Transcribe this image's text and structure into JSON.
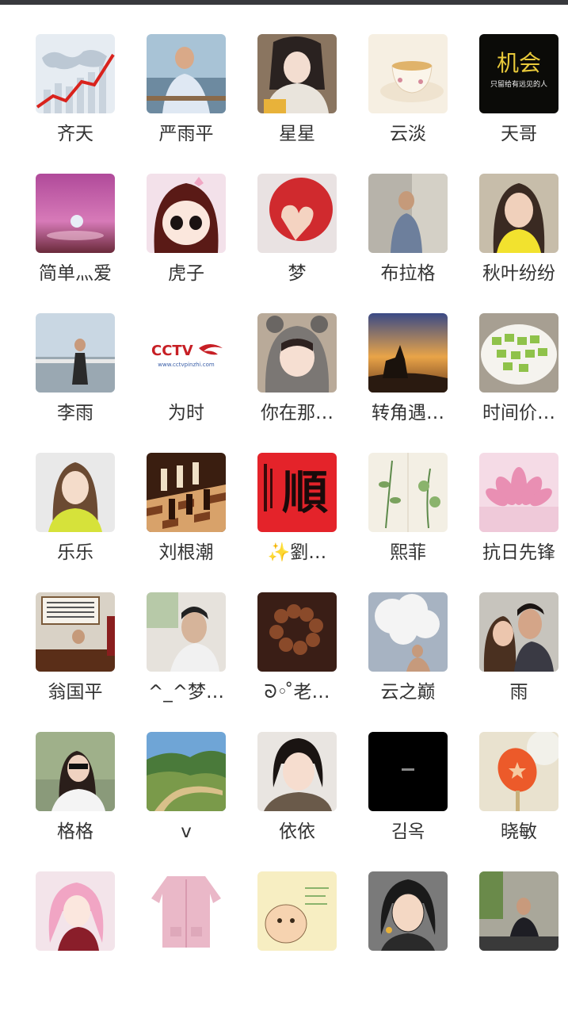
{
  "contacts": [
    {
      "name": "齐天",
      "icon": "world-map-chart-avatar"
    },
    {
      "name": "严雨平",
      "icon": "man-on-boat-avatar"
    },
    {
      "name": "星星",
      "icon": "girl-with-scarf-avatar"
    },
    {
      "name": "云淡",
      "icon": "teacup-avatar"
    },
    {
      "name": "天哥",
      "icon": "opportunity-text-avatar",
      "avatar_text": "机会",
      "avatar_subtext": "只留给有远见的人"
    },
    {
      "name": "简单灬爱",
      "icon": "water-drop-avatar"
    },
    {
      "name": "虎子",
      "icon": "cartoon-girl-avatar"
    },
    {
      "name": "梦",
      "icon": "heart-apple-avatar"
    },
    {
      "name": "布拉格",
      "icon": "mirror-selfie-avatar"
    },
    {
      "name": "秋叶纷纷",
      "icon": "smiling-woman-avatar"
    },
    {
      "name": "李雨",
      "icon": "woman-on-deck-avatar"
    },
    {
      "name": "为时",
      "icon": "cctv-logo-avatar",
      "avatar_text": "CCTV",
      "avatar_subtext": "www.cctvpinzhi.com"
    },
    {
      "name": "你在那…",
      "icon": "child-bear-hat-avatar"
    },
    {
      "name": "转角遇…",
      "icon": "horseman-sunset-avatar"
    },
    {
      "name": "时间价…",
      "icon": "cucumber-plate-avatar"
    },
    {
      "name": "乐乐",
      "icon": "woman-portrait-avatar"
    },
    {
      "name": "刘根潮",
      "icon": "chess-board-avatar"
    },
    {
      "name": "✨劉…",
      "icon": "calligraphy-shun-avatar",
      "avatar_text": "順"
    },
    {
      "name": "熙菲",
      "icon": "botanical-drawing-avatar"
    },
    {
      "name": "抗日先锋",
      "icon": "lotus-flower-avatar"
    },
    {
      "name": "翁国平",
      "icon": "office-desk-avatar"
    },
    {
      "name": "^_^梦…",
      "icon": "man-in-car-avatar"
    },
    {
      "name": "ᘐ◦ ̊老…",
      "icon": "prayer-beads-avatar"
    },
    {
      "name": "云之巅",
      "icon": "smoke-cloud-avatar"
    },
    {
      "name": "雨",
      "icon": "couple-selfie-avatar"
    },
    {
      "name": "格格",
      "icon": "woman-sunglasses-avatar"
    },
    {
      "name": "v",
      "icon": "river-valley-avatar"
    },
    {
      "name": "依依",
      "icon": "girl-pout-avatar"
    },
    {
      "name": "김옥",
      "icon": "black-square-avatar"
    },
    {
      "name": "晓敏",
      "icon": "red-leaf-avatar"
    },
    {
      "name": "",
      "icon": "anime-girl-avatar"
    },
    {
      "name": "",
      "icon": "pink-sweater-avatar"
    },
    {
      "name": "",
      "icon": "cartoon-doodle-avatar"
    },
    {
      "name": "",
      "icon": "cartoon-woman-avatar"
    },
    {
      "name": "",
      "icon": "man-seated-avatar"
    }
  ],
  "colors": {
    "topbar": "#38393d",
    "text": "#333333",
    "background": "#ffffff"
  }
}
